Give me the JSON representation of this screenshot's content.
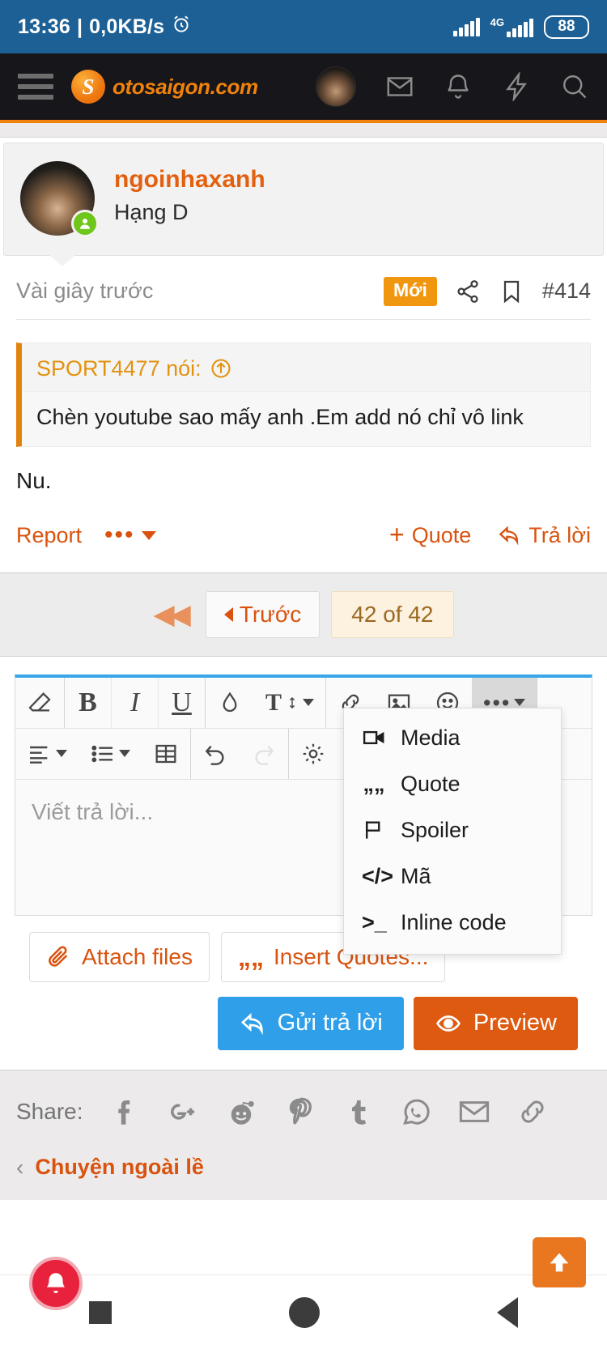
{
  "statusbar": {
    "time": "13:36",
    "separator": "|",
    "netspeed": "0,0KB/s",
    "alarm_icon": "alarm-clock-icon",
    "network_type": "4G",
    "battery": "88"
  },
  "navbar": {
    "menu_icon": "hamburger-menu-icon",
    "brand_mark": "S",
    "brand_text": "otosaigon.com",
    "avatar": "user-avatar",
    "icons": [
      "mail-icon",
      "bell-icon",
      "bolt-icon",
      "search-icon"
    ],
    "accent": "#f0820c"
  },
  "user": {
    "name": "ngoinhaxanh",
    "rank": "Hạng D",
    "online_icon": "online-status-icon"
  },
  "post": {
    "time": "Vài giây trước",
    "badge": "Mới",
    "share_icon": "share-icon",
    "bookmark_icon": "bookmark-icon",
    "number": "#414",
    "quote": {
      "author_line": "SPORT4477 nói:",
      "jump_icon": "jump-up-icon",
      "text": "Chèn youtube sao mấy anh .Em add nó chỉ vô link"
    },
    "body": "Nu.",
    "actions": {
      "report": "Report",
      "more_icon": "more-dots-icon",
      "quote_label": "Quote",
      "quote_plus": "+",
      "reply_label": "Trả lời",
      "reply_icon": "reply-arrow-icon"
    }
  },
  "pagination": {
    "first_icon": "first-page-icon",
    "prev_label": "Trước",
    "current": "42 of 42"
  },
  "editor": {
    "toolbar_row1": [
      {
        "name": "eraser-remove-format-icon",
        "label": "eraser"
      },
      {
        "name": "bold-icon",
        "label": "B"
      },
      {
        "name": "italic-icon",
        "label": "I"
      },
      {
        "name": "underline-icon",
        "label": "U"
      },
      {
        "name": "text-color-drop-icon",
        "label": "drop"
      },
      {
        "name": "font-size-icon",
        "label": "Tt"
      },
      {
        "name": "link-icon",
        "label": "link"
      },
      {
        "name": "image-icon",
        "label": "image"
      },
      {
        "name": "smiley-icon",
        "label": "smiley"
      },
      {
        "name": "more-options-icon",
        "label": "..."
      }
    ],
    "toolbar_row2": [
      {
        "name": "align-icon",
        "label": "align"
      },
      {
        "name": "list-icon",
        "label": "list"
      },
      {
        "name": "table-icon",
        "label": "table"
      },
      {
        "name": "undo-icon",
        "label": "undo"
      },
      {
        "name": "redo-icon",
        "label": "redo"
      },
      {
        "name": "settings-gear-icon",
        "label": "gear"
      }
    ],
    "placeholder": "Viết trả lời...",
    "dropdown": [
      {
        "label": "Media",
        "icon": "video-camera-icon"
      },
      {
        "label": "Quote",
        "icon": "quote-marks-icon"
      },
      {
        "label": "Spoiler",
        "icon": "flag-icon"
      },
      {
        "label": "Mã",
        "icon": "code-brackets-icon"
      },
      {
        "label": "Inline code",
        "icon": "terminal-prompt-icon"
      }
    ],
    "attach_label": "Attach files",
    "attach_icon": "paperclip-icon",
    "insert_quotes_label": "Insert Quotes...",
    "insert_quotes_icon": "quote-marks-icon",
    "submit_label": "Gửi trả lời",
    "submit_icon": "reply-arrow-icon",
    "preview_label": "Preview",
    "preview_icon": "eye-icon",
    "submit_color": "#2e9fe8",
    "preview_color": "#de5a10"
  },
  "share": {
    "label": "Share:",
    "icons": [
      "facebook-icon",
      "google-plus-icon",
      "reddit-icon",
      "pinterest-icon",
      "tumblr-icon",
      "whatsapp-icon",
      "email-icon",
      "link-icon"
    ]
  },
  "breadcrumb": {
    "back_arrow": "‹",
    "link": "Chuyện ngoài lề"
  },
  "floating": {
    "bell_icon": "notification-bell-icon",
    "scrolltop_icon": "scroll-to-top-icon"
  },
  "androidnav": {
    "recent": "recent-apps-button",
    "home": "home-button",
    "back": "back-button"
  }
}
